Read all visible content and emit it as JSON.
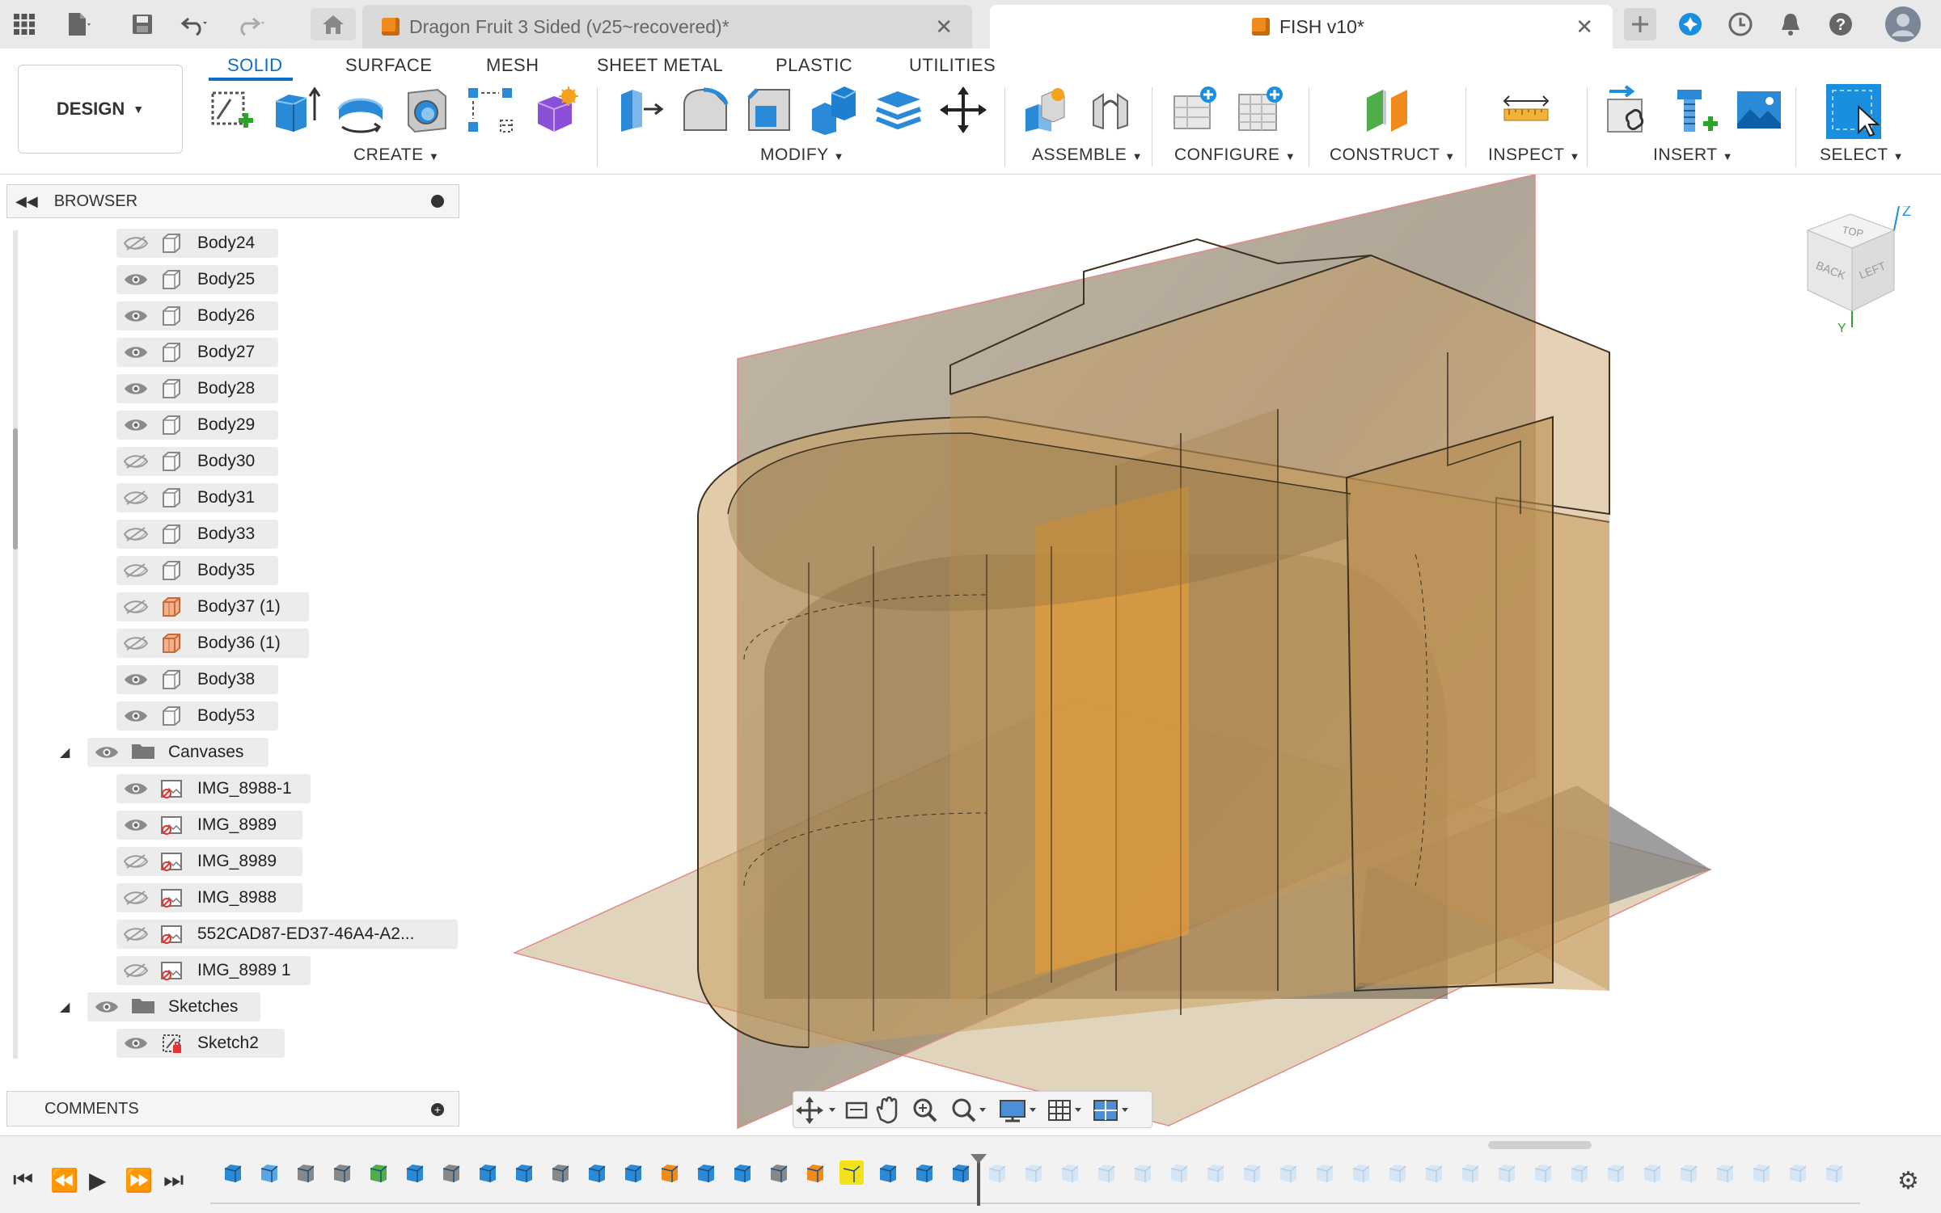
{
  "app": {
    "tabs": [
      {
        "label": "Dragon Fruit 3 Sided (v25~recovered)*",
        "active": false
      },
      {
        "label": "FISH v10*",
        "active": true
      }
    ],
    "close_glyph": "✕",
    "icons": [
      "apps-grid-icon",
      "file-icon",
      "save-icon",
      "undo-icon",
      "redo-icon",
      "home-icon",
      "new-tab-icon",
      "extensions-icon",
      "clock-icon",
      "bell-icon",
      "help-icon",
      "avatar"
    ]
  },
  "ribbon": {
    "workspace": "DESIGN",
    "tabs": [
      "SOLID",
      "SURFACE",
      "MESH",
      "SHEET METAL",
      "PLASTIC",
      "UTILITIES"
    ],
    "active_tab": "SOLID",
    "groups": [
      "CREATE",
      "MODIFY",
      "ASSEMBLE",
      "CONFIGURE",
      "CONSTRUCT",
      "INSPECT",
      "INSERT",
      "SELECT"
    ],
    "accent": "#0b6ec9"
  },
  "browser": {
    "title": "BROWSER",
    "bodies": [
      {
        "name": "Body24",
        "visible": false
      },
      {
        "name": "Body25",
        "visible": true
      },
      {
        "name": "Body26",
        "visible": true
      },
      {
        "name": "Body27",
        "visible": true
      },
      {
        "name": "Body28",
        "visible": true
      },
      {
        "name": "Body29",
        "visible": true
      },
      {
        "name": "Body30",
        "visible": false
      },
      {
        "name": "Body31",
        "visible": false
      },
      {
        "name": "Body33",
        "visible": false
      },
      {
        "name": "Body35",
        "visible": false
      },
      {
        "name": "Body37 (1)",
        "visible": false,
        "orange": true
      },
      {
        "name": "Body36 (1)",
        "visible": false,
        "orange": true
      },
      {
        "name": "Body38",
        "visible": true
      },
      {
        "name": "Body53",
        "visible": true
      }
    ],
    "canvases_label": "Canvases",
    "canvases": [
      {
        "name": "IMG_8988-1",
        "visible": true
      },
      {
        "name": "IMG_8989",
        "visible": true
      },
      {
        "name": "IMG_8989",
        "visible": false
      },
      {
        "name": "IMG_8988",
        "visible": false
      },
      {
        "name": "552CAD87-ED37-46A4-A2...",
        "visible": false
      },
      {
        "name": "IMG_8989 1",
        "visible": false
      }
    ],
    "sketches_label": "Sketches",
    "sketches": [
      {
        "name": "Sketch2",
        "visible": true
      }
    ]
  },
  "comments": {
    "title": "COMMENTS"
  },
  "viewcube": {
    "faces": [
      "TOP",
      "BACK",
      "LEFT"
    ],
    "axes": [
      "Z",
      "Y"
    ]
  },
  "timeline": {
    "controls": [
      "first",
      "prev",
      "play",
      "next",
      "last"
    ]
  }
}
